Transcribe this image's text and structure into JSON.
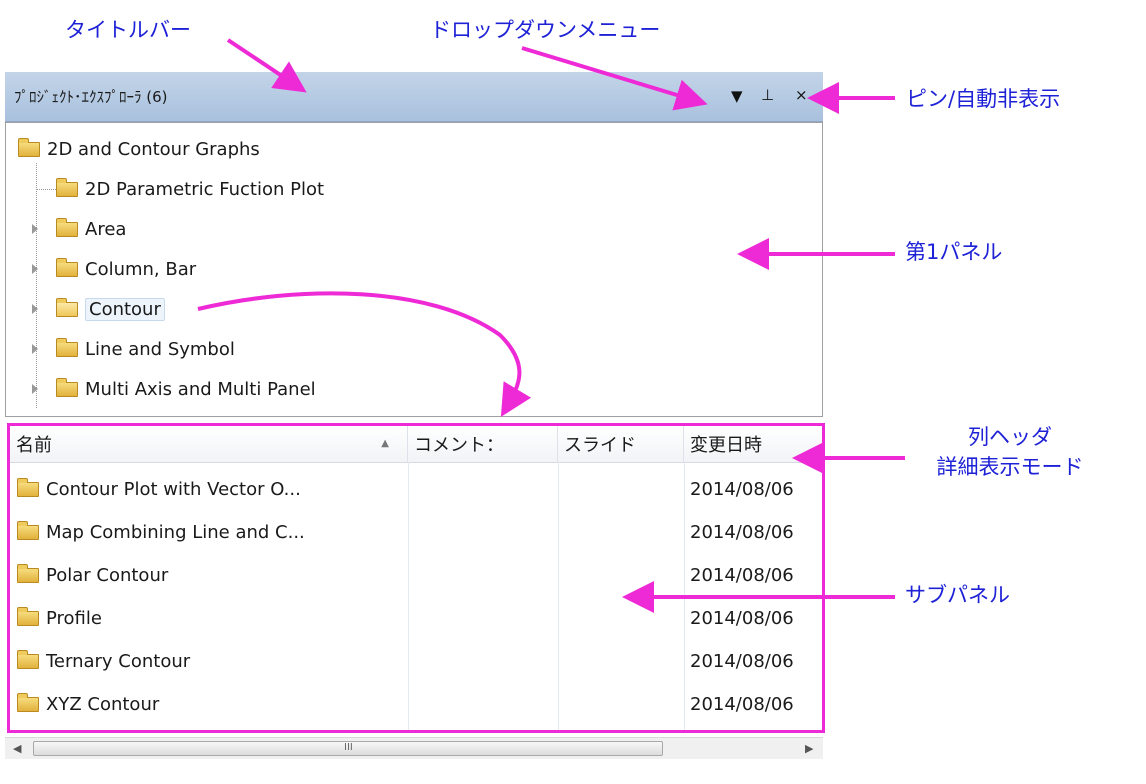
{
  "annotations": {
    "title_bar": "タイトルバー",
    "dropdown_menu": "ドロップダウンメニュー",
    "pin_autohide": "ピン/自動非表示",
    "first_panel": "第1パネル",
    "column_header": "列ヘッダ",
    "detail_mode": "詳細表示モード",
    "sub_panel": "サブパネル"
  },
  "window": {
    "title": "ﾌﾟﾛｼﾞｪｸﾄ･ｴｸｽﾌﾟﾛｰﾗ (6)",
    "dropdown_glyph": "▼",
    "pin_glyph": "⊥",
    "close_glyph": "×"
  },
  "tree": {
    "root": "2D and Contour Graphs",
    "children": [
      {
        "label": "2D Parametric Fuction Plot",
        "expandable": false
      },
      {
        "label": "Area",
        "expandable": true
      },
      {
        "label": "Column, Bar",
        "expandable": true
      },
      {
        "label": "Contour",
        "expandable": true,
        "selected": true
      },
      {
        "label": "Line and Symbol",
        "expandable": true
      },
      {
        "label": "Multi Axis and Multi Panel",
        "expandable": true
      }
    ]
  },
  "list": {
    "columns": [
      "名前",
      "コメント：",
      "スライド",
      "変更日時"
    ],
    "sort_glyph": "▲",
    "rows": [
      {
        "name": "Contour Plot with Vector O...",
        "date": "2014/08/06"
      },
      {
        "name": "Map Combining Line and C...",
        "date": "2014/08/06"
      },
      {
        "name": "Polar Contour",
        "date": "2014/08/06"
      },
      {
        "name": "Profile",
        "date": "2014/08/06"
      },
      {
        "name": "Ternary Contour",
        "date": "2014/08/06"
      },
      {
        "name": "XYZ Contour",
        "date": "2014/08/06"
      }
    ]
  },
  "scrollbar": {
    "left_glyph": "◀",
    "right_glyph": "▶",
    "grip_glyph": "III"
  },
  "colors": {
    "annotation_text": "#1e22d6",
    "annotation_arrow": "#ee2ad6",
    "titlebar": "#b4c8e2"
  }
}
